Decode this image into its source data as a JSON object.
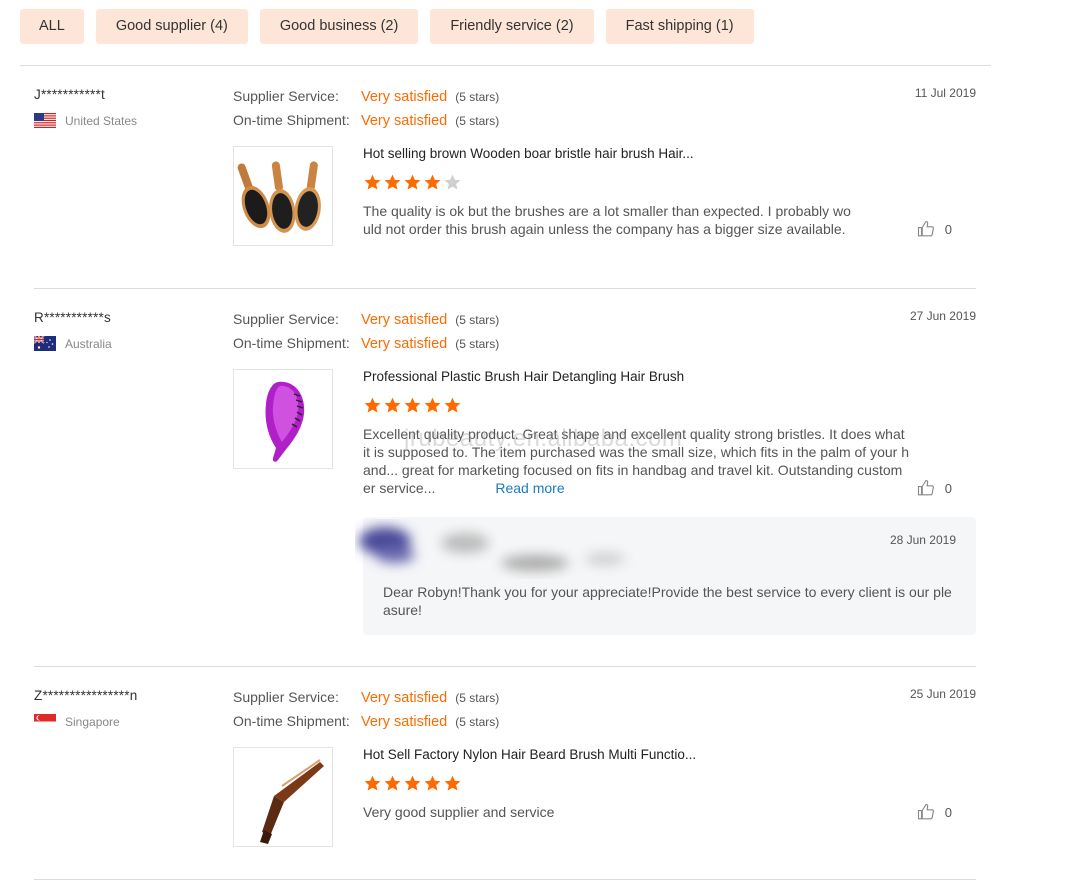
{
  "filters": {
    "all": "ALL",
    "good_supplier": "Good supplier (4)",
    "good_business": "Good business (2)",
    "friendly_service": "Friendly service (2)",
    "fast_shipping": "Fast shipping (1)"
  },
  "colors": {
    "accent": "#ff6a00",
    "tab_bg": "#fde6d8",
    "link": "#1a7bbf"
  },
  "watermark": "jrubeauty.en.alibaba.com",
  "reviews": [
    {
      "user": "J***********t",
      "country": "United States",
      "flag": "us-flag",
      "date": "11 Jul 2019",
      "supplier_label": "Supplier Service:",
      "supplier_value": "Very satisfied",
      "supplier_stars": "(5 stars)",
      "shipment_label": "On-time Shipment:",
      "shipment_value": "Very satisfied",
      "shipment_stars": "(5 stars)",
      "product": "Hot selling brown Wooden boar bristle hair brush Hair...",
      "rating": 4,
      "text_1": "The quality is ok but the brushes are a lot smaller than expected. I probably wo",
      "text_2": "uld not order this brush again unless the company has a bigger size available.",
      "likes": "0"
    },
    {
      "user": "R***********s",
      "country": "Australia",
      "flag": "au-flag",
      "date": "27 Jun 2019",
      "supplier_label": "Supplier Service:",
      "supplier_value": "Very satisfied",
      "supplier_stars": "(5 stars)",
      "shipment_label": "On-time Shipment:",
      "shipment_value": "Very satisfied",
      "shipment_stars": "(5 stars)",
      "product": "Professional Plastic Brush Hair Detangling Hair Brush",
      "rating": 5,
      "text_1": "Excellent quality product. Great shape and excellent quality strong bristles. It does what",
      "text_2": "it is supposed to. The item purchased was the small size, which fits in the palm of your h",
      "text_3": "and... great for marketing focused on fits in handbag and travel kit. Outstanding custom",
      "text_4": "er service...",
      "read_more": "Read more",
      "likes": "0",
      "reply_date": "28 Jun 2019",
      "reply_1": "Dear Robyn!Thank you for your appreciate!Provide the best service to every client is our ple",
      "reply_2": "asure!"
    },
    {
      "user": "Z****************n",
      "country": "Singapore",
      "flag": "sg-flag",
      "date": "25 Jun 2019",
      "supplier_label": "Supplier Service:",
      "supplier_value": "Very satisfied",
      "supplier_stars": "(5 stars)",
      "shipment_label": "On-time Shipment:",
      "shipment_value": "Very satisfied",
      "shipment_stars": "(5 stars)",
      "product": "Hot Sell Factory Nylon Hair Beard Brush Multi Functio...",
      "rating": 5,
      "text_1": "Very good supplier and service",
      "likes": "0"
    }
  ]
}
